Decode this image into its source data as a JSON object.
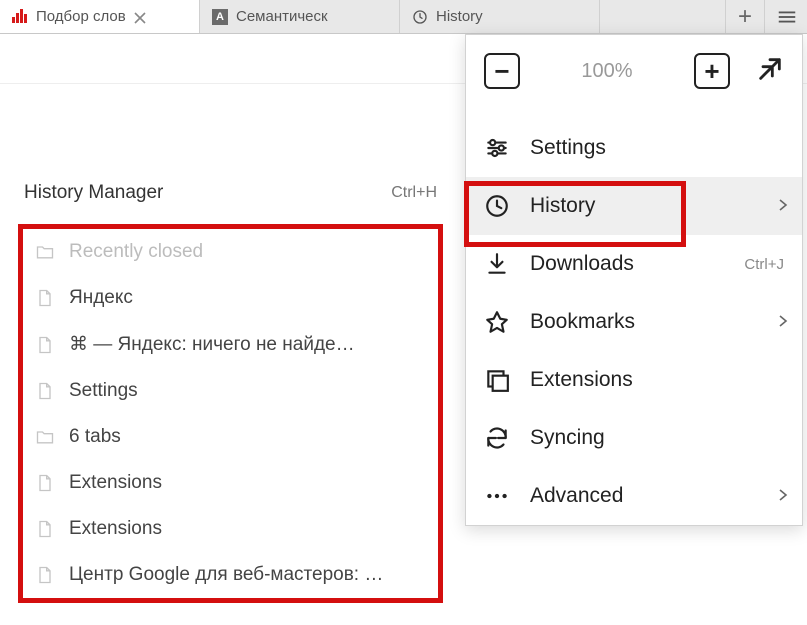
{
  "tabs": [
    {
      "label": "Подбор слов"
    },
    {
      "label": "Семантическ"
    },
    {
      "label": "History"
    }
  ],
  "zoom": {
    "value": "100%"
  },
  "menu": {
    "items": [
      {
        "key": "settings",
        "label": "Settings",
        "shortcut": "",
        "chevron": false
      },
      {
        "key": "history",
        "label": "History",
        "shortcut": "",
        "chevron": true
      },
      {
        "key": "downloads",
        "label": "Downloads",
        "shortcut": "Ctrl+J",
        "chevron": false
      },
      {
        "key": "bookmarks",
        "label": "Bookmarks",
        "shortcut": "",
        "chevron": true
      },
      {
        "key": "extensions",
        "label": "Extensions",
        "shortcut": "",
        "chevron": false
      },
      {
        "key": "syncing",
        "label": "Syncing",
        "shortcut": "",
        "chevron": false
      },
      {
        "key": "advanced",
        "label": "Advanced",
        "shortcut": "",
        "chevron": true
      }
    ]
  },
  "history_panel": {
    "title": "History Manager",
    "shortcut": "Ctrl+H",
    "items": [
      {
        "label": "Recently closed",
        "kind": "folder",
        "light": true
      },
      {
        "label": "Яндекс",
        "kind": "page"
      },
      {
        "label": "⌘ — Яндекс: ничего не найде…",
        "kind": "page"
      },
      {
        "label": "Settings",
        "kind": "page"
      },
      {
        "label": "6 tabs",
        "kind": "folder"
      },
      {
        "label": "Extensions",
        "kind": "page"
      },
      {
        "label": "Extensions",
        "kind": "page"
      },
      {
        "label": "Центр Google для веб-мастеров: …",
        "kind": "page"
      }
    ]
  }
}
